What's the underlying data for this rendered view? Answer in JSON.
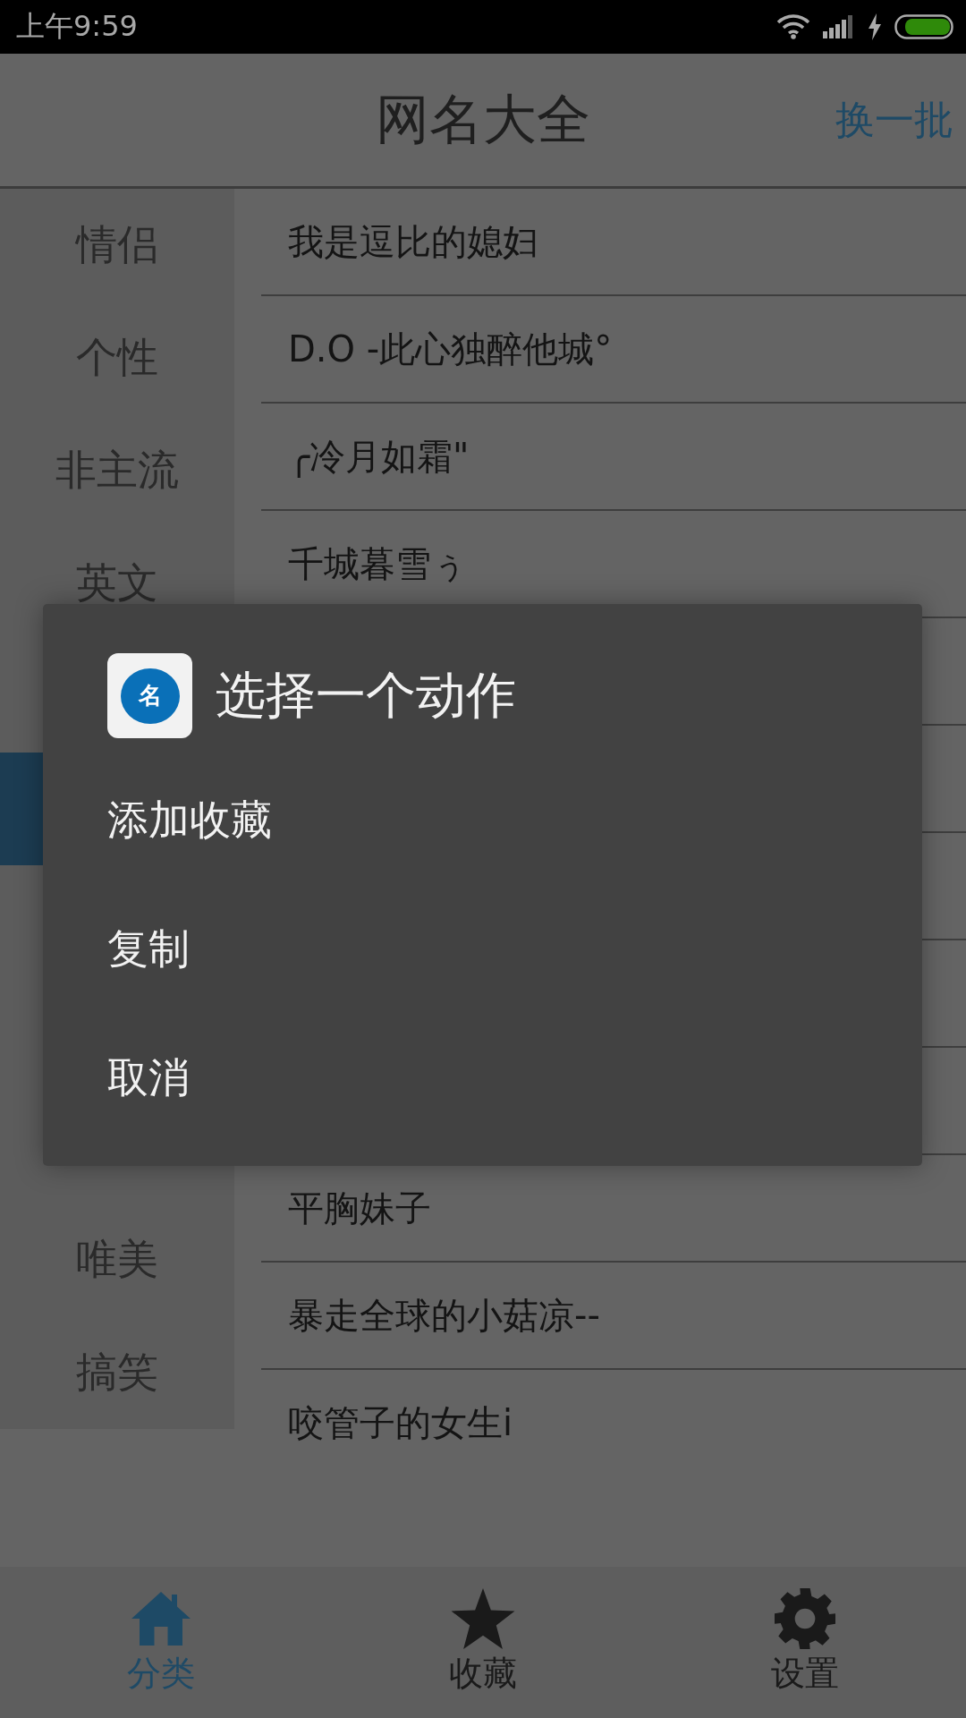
{
  "status_bar": {
    "time": "上午9:59"
  },
  "header": {
    "title": "网名大全",
    "action": "换一批"
  },
  "sidebar": {
    "items": [
      {
        "label": "情侣",
        "selected": false
      },
      {
        "label": "个性",
        "selected": false
      },
      {
        "label": "非主流",
        "selected": false
      },
      {
        "label": "英文",
        "selected": false
      },
      {
        "selected": false
      },
      {
        "selected": true
      },
      {
        "selected": false
      },
      {
        "selected": false
      },
      {
        "selected": false
      },
      {
        "label": "唯美",
        "selected": false
      },
      {
        "label": "搞笑",
        "selected": false
      }
    ]
  },
  "names": [
    {
      "text": "我是逗比的媳妇"
    },
    {
      "text": "D.O -此心独醉他城°"
    },
    {
      "text": "╭冷月如霜\""
    },
    {
      "text": "千城暮雪ぅ"
    },
    {
      "text": "平胸妹子"
    },
    {
      "text": "暴走全球的小菇凉--"
    },
    {
      "text": "咬管子的女生i"
    }
  ],
  "dialog": {
    "title": "选择一个动作",
    "app_icon_text": "名",
    "options": [
      "添加收藏",
      "复制",
      "取消"
    ]
  },
  "bottom_nav": [
    {
      "label": "分类",
      "kind": "home",
      "selected": true
    },
    {
      "label": "收藏",
      "kind": "star",
      "selected": false
    },
    {
      "label": "设置",
      "kind": "settings",
      "selected": false
    }
  ]
}
